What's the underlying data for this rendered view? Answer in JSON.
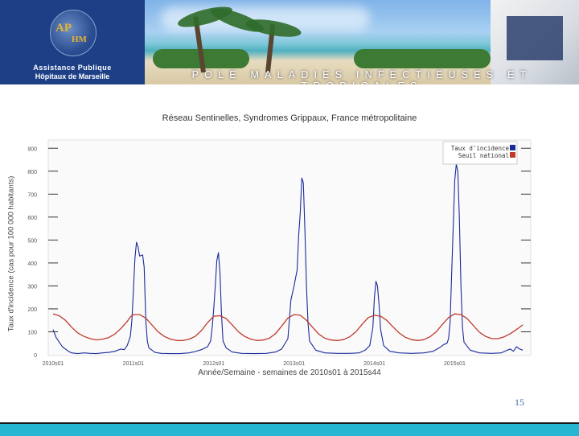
{
  "header": {
    "org_line1": "Assistance Publique",
    "org_line2": "Hôpitaux de Marseille",
    "logo_text_ap": "AP",
    "logo_text_hm": "HM",
    "banner_title": "POLE MALADIES INFECTIEUSES ET TROPICALES"
  },
  "colors": {
    "header_blue": "#1d3f86",
    "incidence_line": "#1a2a9a",
    "threshold_line": "#c0392b",
    "footer_bar": "#27b6d1"
  },
  "page_number": "15",
  "chart_data": {
    "type": "line",
    "title": "Réseau Sentinelles, Syndromes Grippaux, France métropolitaine",
    "xlabel": "Année/Semaine - semaines de 2010s01 à 2015s44",
    "ylabel": "Taux d'incidence (cas pour 100 000 habitants)",
    "ylim": [
      0,
      950
    ],
    "y_ticks": [
      "0",
      "100",
      "200",
      "300",
      "400",
      "500",
      "600",
      "700",
      "800",
      "900"
    ],
    "x_ticks": [
      {
        "label": "2010s01",
        "week": 0
      },
      {
        "label": "2011s01",
        "week": 52
      },
      {
        "label": "2012s01",
        "week": 104
      },
      {
        "label": "2013s01",
        "week": 156
      },
      {
        "label": "2014s01",
        "week": 208
      },
      {
        "label": "2015s01",
        "week": 260
      }
    ],
    "x_range_weeks": [
      0,
      304
    ],
    "grid": true,
    "legend_position": "top-right",
    "series": [
      {
        "name": "Taux d'incidence",
        "points": [
          [
            0,
            110
          ],
          [
            2,
            75
          ],
          [
            4,
            55
          ],
          [
            6,
            35
          ],
          [
            8,
            25
          ],
          [
            10,
            15
          ],
          [
            12,
            8
          ],
          [
            16,
            5
          ],
          [
            20,
            8
          ],
          [
            24,
            6
          ],
          [
            28,
            5
          ],
          [
            32,
            8
          ],
          [
            36,
            10
          ],
          [
            40,
            15
          ],
          [
            44,
            25
          ],
          [
            46,
            22
          ],
          [
            48,
            40
          ],
          [
            50,
            80
          ],
          [
            51,
            150
          ],
          [
            52,
            280
          ],
          [
            53,
            420
          ],
          [
            54,
            490
          ],
          [
            55,
            470
          ],
          [
            56,
            430
          ],
          [
            58,
            435
          ],
          [
            59,
            380
          ],
          [
            60,
            150
          ],
          [
            61,
            60
          ],
          [
            62,
            30
          ],
          [
            66,
            10
          ],
          [
            70,
            6
          ],
          [
            76,
            5
          ],
          [
            82,
            5
          ],
          [
            88,
            8
          ],
          [
            92,
            14
          ],
          [
            96,
            22
          ],
          [
            100,
            35
          ],
          [
            102,
            60
          ],
          [
            103,
            120
          ],
          [
            104,
            200
          ],
          [
            105,
            300
          ],
          [
            106,
            410
          ],
          [
            107,
            445
          ],
          [
            108,
            360
          ],
          [
            109,
            180
          ],
          [
            110,
            60
          ],
          [
            112,
            30
          ],
          [
            116,
            12
          ],
          [
            122,
            6
          ],
          [
            130,
            5
          ],
          [
            138,
            6
          ],
          [
            144,
            12
          ],
          [
            148,
            25
          ],
          [
            152,
            70
          ],
          [
            154,
            240
          ],
          [
            156,
            300
          ],
          [
            158,
            370
          ],
          [
            159,
            520
          ],
          [
            160,
            620
          ],
          [
            161,
            770
          ],
          [
            162,
            750
          ],
          [
            163,
            550
          ],
          [
            164,
            300
          ],
          [
            165,
            140
          ],
          [
            166,
            60
          ],
          [
            170,
            20
          ],
          [
            176,
            8
          ],
          [
            184,
            6
          ],
          [
            192,
            6
          ],
          [
            198,
            8
          ],
          [
            202,
            20
          ],
          [
            205,
            40
          ],
          [
            207,
            120
          ],
          [
            208,
            250
          ],
          [
            209,
            320
          ],
          [
            210,
            300
          ],
          [
            211,
            220
          ],
          [
            212,
            110
          ],
          [
            214,
            40
          ],
          [
            218,
            15
          ],
          [
            224,
            8
          ],
          [
            232,
            6
          ],
          [
            240,
            8
          ],
          [
            246,
            15
          ],
          [
            250,
            30
          ],
          [
            253,
            45
          ],
          [
            255,
            50
          ],
          [
            256,
            70
          ],
          [
            257,
            140
          ],
          [
            258,
            350
          ],
          [
            259,
            560
          ],
          [
            260,
            760
          ],
          [
            261,
            830
          ],
          [
            262,
            800
          ],
          [
            263,
            600
          ],
          [
            264,
            300
          ],
          [
            265,
            120
          ],
          [
            266,
            55
          ],
          [
            270,
            20
          ],
          [
            276,
            8
          ],
          [
            284,
            6
          ],
          [
            290,
            8
          ],
          [
            294,
            20
          ],
          [
            296,
            25
          ],
          [
            298,
            15
          ],
          [
            300,
            35
          ],
          [
            302,
            25
          ],
          [
            304,
            20
          ]
        ]
      },
      {
        "name": "Seuil national",
        "points": [
          [
            0,
            178
          ],
          [
            4,
            170
          ],
          [
            8,
            150
          ],
          [
            12,
            120
          ],
          [
            16,
            95
          ],
          [
            20,
            80
          ],
          [
            24,
            70
          ],
          [
            28,
            65
          ],
          [
            32,
            68
          ],
          [
            36,
            75
          ],
          [
            40,
            90
          ],
          [
            44,
            115
          ],
          [
            48,
            145
          ],
          [
            50,
            165
          ],
          [
            52,
            175
          ],
          [
            56,
            175
          ],
          [
            60,
            160
          ],
          [
            64,
            130
          ],
          [
            68,
            100
          ],
          [
            72,
            80
          ],
          [
            76,
            68
          ],
          [
            80,
            62
          ],
          [
            84,
            62
          ],
          [
            88,
            68
          ],
          [
            92,
            80
          ],
          [
            96,
            105
          ],
          [
            100,
            140
          ],
          [
            104,
            168
          ],
          [
            108,
            170
          ],
          [
            112,
            158
          ],
          [
            116,
            130
          ],
          [
            120,
            100
          ],
          [
            124,
            80
          ],
          [
            128,
            68
          ],
          [
            132,
            62
          ],
          [
            136,
            64
          ],
          [
            140,
            72
          ],
          [
            144,
            92
          ],
          [
            148,
            125
          ],
          [
            152,
            160
          ],
          [
            156,
            175
          ],
          [
            160,
            172
          ],
          [
            164,
            150
          ],
          [
            168,
            120
          ],
          [
            172,
            90
          ],
          [
            176,
            72
          ],
          [
            180,
            64
          ],
          [
            184,
            62
          ],
          [
            188,
            66
          ],
          [
            192,
            78
          ],
          [
            196,
            100
          ],
          [
            200,
            132
          ],
          [
            204,
            162
          ],
          [
            208,
            172
          ],
          [
            212,
            168
          ],
          [
            216,
            150
          ],
          [
            220,
            122
          ],
          [
            224,
            95
          ],
          [
            228,
            76
          ],
          [
            232,
            66
          ],
          [
            236,
            62
          ],
          [
            240,
            66
          ],
          [
            244,
            78
          ],
          [
            248,
            100
          ],
          [
            252,
            132
          ],
          [
            256,
            162
          ],
          [
            260,
            178
          ],
          [
            264,
            175
          ],
          [
            268,
            158
          ],
          [
            272,
            128
          ],
          [
            276,
            98
          ],
          [
            280,
            80
          ],
          [
            284,
            70
          ],
          [
            288,
            70
          ],
          [
            292,
            78
          ],
          [
            296,
            92
          ],
          [
            300,
            110
          ],
          [
            304,
            130
          ]
        ]
      }
    ]
  }
}
